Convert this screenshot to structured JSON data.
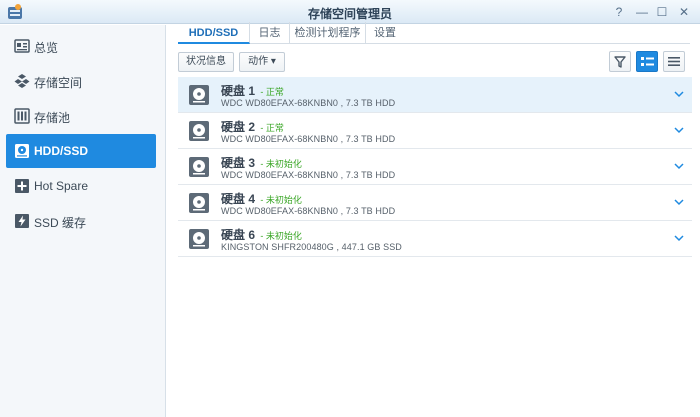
{
  "window": {
    "title": "存储空间管理员",
    "help": "?",
    "minimize": "—",
    "maximize": "☐",
    "close": "✕"
  },
  "sidebar": {
    "items": [
      {
        "label": "总览",
        "icon": "overview-icon"
      },
      {
        "label": "存储空间",
        "icon": "volume-icon"
      },
      {
        "label": "存储池",
        "icon": "storage-pool-icon"
      },
      {
        "label": "HDD/SSD",
        "icon": "hdd-icon",
        "active": true
      },
      {
        "label": "Hot Spare",
        "icon": "hot-spare-icon"
      },
      {
        "label": "SSD 缓存",
        "icon": "ssd-cache-icon"
      }
    ]
  },
  "tabs": [
    {
      "label": "HDD/SSD",
      "active": true
    },
    {
      "label": "日志"
    },
    {
      "label": "检测计划程序"
    },
    {
      "label": "设置"
    }
  ],
  "toolbar": {
    "status_info": "状况信息",
    "action": "动作 ▾",
    "filter_icon": "filter-icon",
    "list_view_icon": "detail-list-icon",
    "compact_view_icon": "compact-list-icon"
  },
  "disks": [
    {
      "name": "硬盘 1",
      "status": "- 正常",
      "model": "WDC WD80EFAX-68KNBN0 , 7.3 TB HDD",
      "selected": true
    },
    {
      "name": "硬盘 2",
      "status": "- 正常",
      "model": "WDC WD80EFAX-68KNBN0 , 7.3 TB HDD"
    },
    {
      "name": "硬盘 3",
      "status": "- 未初始化",
      "model": "WDC WD80EFAX-68KNBN0 , 7.3 TB HDD"
    },
    {
      "name": "硬盘 4",
      "status": "- 未初始化",
      "model": "WDC WD80EFAX-68KNBN0 , 7.3 TB HDD"
    },
    {
      "name": "硬盘 6",
      "status": "- 未初始化",
      "model": "KINGSTON SHFR200480G , 447.1 GB SSD"
    }
  ],
  "colors": {
    "accent": "#1f8ae0",
    "status_ok": "#3aa626",
    "status_uninit": "#3aa626"
  }
}
